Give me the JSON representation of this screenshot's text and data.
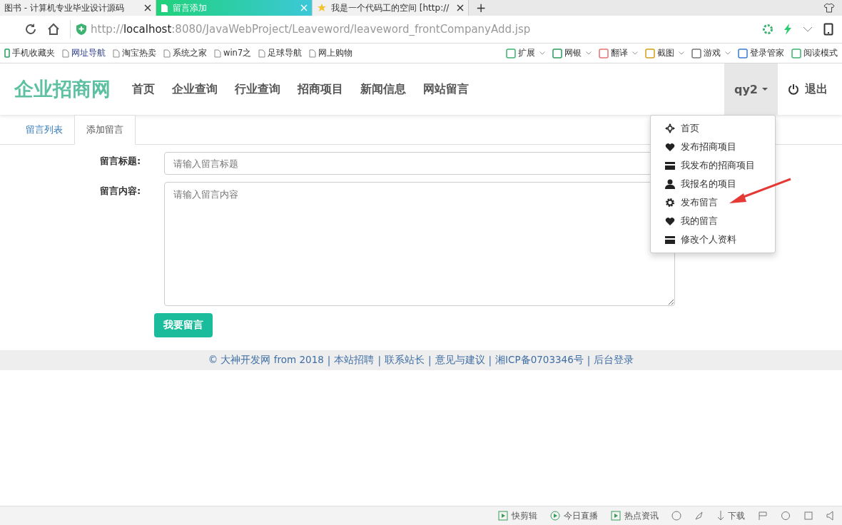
{
  "browser": {
    "tabs": [
      {
        "title": "图书 - 计算机专业毕业设计源码",
        "selected": false,
        "kind": "plain"
      },
      {
        "title": "留言添加",
        "selected": true,
        "kind": "page"
      },
      {
        "title": "我是一个代码工的空间 [http://",
        "selected": false,
        "kind": "star"
      }
    ],
    "new_tab": "+",
    "url_host": "localhost",
    "url_scheme": "http://",
    "url_rest": ":8080/JavaWebProject/Leaveword/leaveword_frontCompanyAdd.jsp",
    "bookmarks": [
      {
        "label": "手机收藏夹",
        "kind": "phone"
      },
      {
        "label": "网址导航",
        "kind": "page"
      },
      {
        "label": "淘宝热卖",
        "kind": "page"
      },
      {
        "label": "系统之家",
        "kind": "page"
      },
      {
        "label": "win7之",
        "kind": "page"
      },
      {
        "label": "足球导航",
        "kind": "page"
      },
      {
        "label": "网上购物",
        "kind": "page"
      }
    ],
    "tools": [
      {
        "label": "扩展",
        "dropdown": true
      },
      {
        "label": "网银",
        "dropdown": true
      },
      {
        "label": "翻译",
        "dropdown": true
      },
      {
        "label": "截图",
        "dropdown": true
      },
      {
        "label": "游戏",
        "dropdown": true
      },
      {
        "label": "登录管家",
        "dropdown": false
      },
      {
        "label": "阅读模式",
        "dropdown": false
      }
    ]
  },
  "site": {
    "logo": "企业招商网",
    "nav": [
      "首页",
      "企业查询",
      "行业查询",
      "招商项目",
      "新闻信息",
      "网站留言"
    ],
    "user": "qy2",
    "logout": "退出",
    "menu": [
      {
        "label": "首页",
        "kind": "move"
      },
      {
        "label": "发布招商项目",
        "kind": "heart"
      },
      {
        "label": "我发布的招商项目",
        "kind": "card"
      },
      {
        "label": "我报名的项目",
        "kind": "user"
      },
      {
        "label": "发布留言",
        "kind": "gear"
      },
      {
        "label": "我的留言",
        "kind": "heart"
      },
      {
        "label": "修改个人资料",
        "kind": "card"
      }
    ],
    "tabs": [
      {
        "label": "留言列表",
        "selected": false
      },
      {
        "label": "添加留言",
        "selected": true
      }
    ],
    "form": {
      "title_label": "留言标题:",
      "title_placeholder": "请输入留言标题",
      "content_label": "留言内容:",
      "content_placeholder": "请输入留言内容",
      "submit": "我要留言"
    },
    "footer": {
      "copyright": "© 大神开发网 from 2018",
      "separator": "|",
      "links": [
        "本站招聘",
        "联系站长",
        "意见与建议",
        "湘ICP备0703346号",
        "后台登录"
      ]
    }
  },
  "status_bar": {
    "items": [
      {
        "label": "快剪辑",
        "kind": "box"
      },
      {
        "label": "今日直播",
        "kind": "circle"
      },
      {
        "label": "热点资讯",
        "kind": "box"
      }
    ],
    "download": "下载"
  }
}
